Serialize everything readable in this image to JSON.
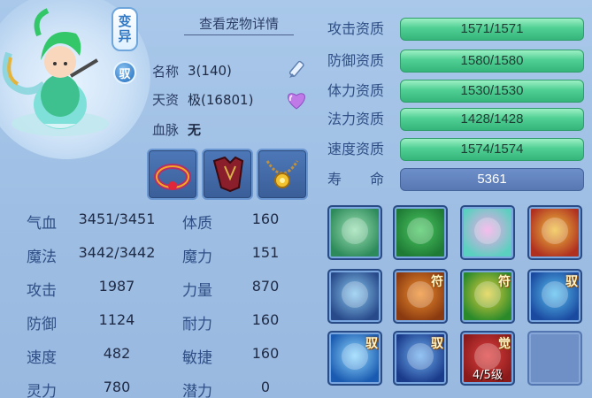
{
  "pet": {
    "mutation_tag": [
      "变",
      "异"
    ],
    "tame_badge": "驭",
    "detail_link": "查看宠物详情",
    "name_label": "名称",
    "name_value": "3(140)",
    "talent_label": "天资",
    "talent_value": "极(16801)",
    "bloodline_label": "血脉",
    "bloodline_value": "无"
  },
  "equipment": [
    "collar-item",
    "armor-item",
    "necklace-item"
  ],
  "stats": [
    {
      "label": "气血",
      "value": "3451/3451",
      "label2": "体质",
      "value2": "160"
    },
    {
      "label": "魔法",
      "value": "3442/3442",
      "label2": "魔力",
      "value2": "151"
    },
    {
      "label": "攻击",
      "value": "1987",
      "label2": "力量",
      "value2": "870"
    },
    {
      "label": "防御",
      "value": "1124",
      "label2": "耐力",
      "value2": "160"
    },
    {
      "label": "速度",
      "value": "482",
      "label2": "敏捷",
      "value2": "160"
    },
    {
      "label": "灵力",
      "value": "780",
      "label2": "潜力",
      "value2": "0"
    }
  ],
  "aptitudes": [
    {
      "label": "攻击资质",
      "value": "1571/1571"
    },
    {
      "label": "防御资质",
      "value": "1580/1580"
    },
    {
      "label": "体力资质",
      "value": "1530/1530"
    },
    {
      "label": "法力资质",
      "value": "1428/1428"
    },
    {
      "label": "速度资质",
      "value": "1574/1574"
    }
  ],
  "life": {
    "label": "寿　　命",
    "value": "5361"
  },
  "skills": [
    {
      "name": "horse-skill-icon",
      "tag": "",
      "level": ""
    },
    {
      "name": "strength-skill-icon",
      "tag": "",
      "level": ""
    },
    {
      "name": "heart-skill-icon",
      "tag": "",
      "level": ""
    },
    {
      "name": "blade-skill-icon",
      "tag": "",
      "level": ""
    },
    {
      "name": "ghost-claw-skill-icon",
      "tag": "",
      "level": ""
    },
    {
      "name": "beast-rune-skill-icon",
      "tag": "符",
      "level": ""
    },
    {
      "name": "shield-rune-skill-icon",
      "tag": "符",
      "level": ""
    },
    {
      "name": "wolf-skill-icon",
      "tag": "驭",
      "level": ""
    },
    {
      "name": "guard-shield-skill-icon",
      "tag": "驭",
      "level": ""
    },
    {
      "name": "wind-shield-skill-icon",
      "tag": "驭",
      "level": ""
    },
    {
      "name": "awaken-skill-icon",
      "tag": "觉",
      "level": "4/5级"
    },
    {
      "name": "empty-skill-slot",
      "tag": "",
      "level": ""
    }
  ],
  "colors": {
    "background": "#a9c8ea",
    "aptitude_bar": "#4fcf93",
    "life_bar": "#5878b3",
    "label_blue": "#2f4f86"
  }
}
